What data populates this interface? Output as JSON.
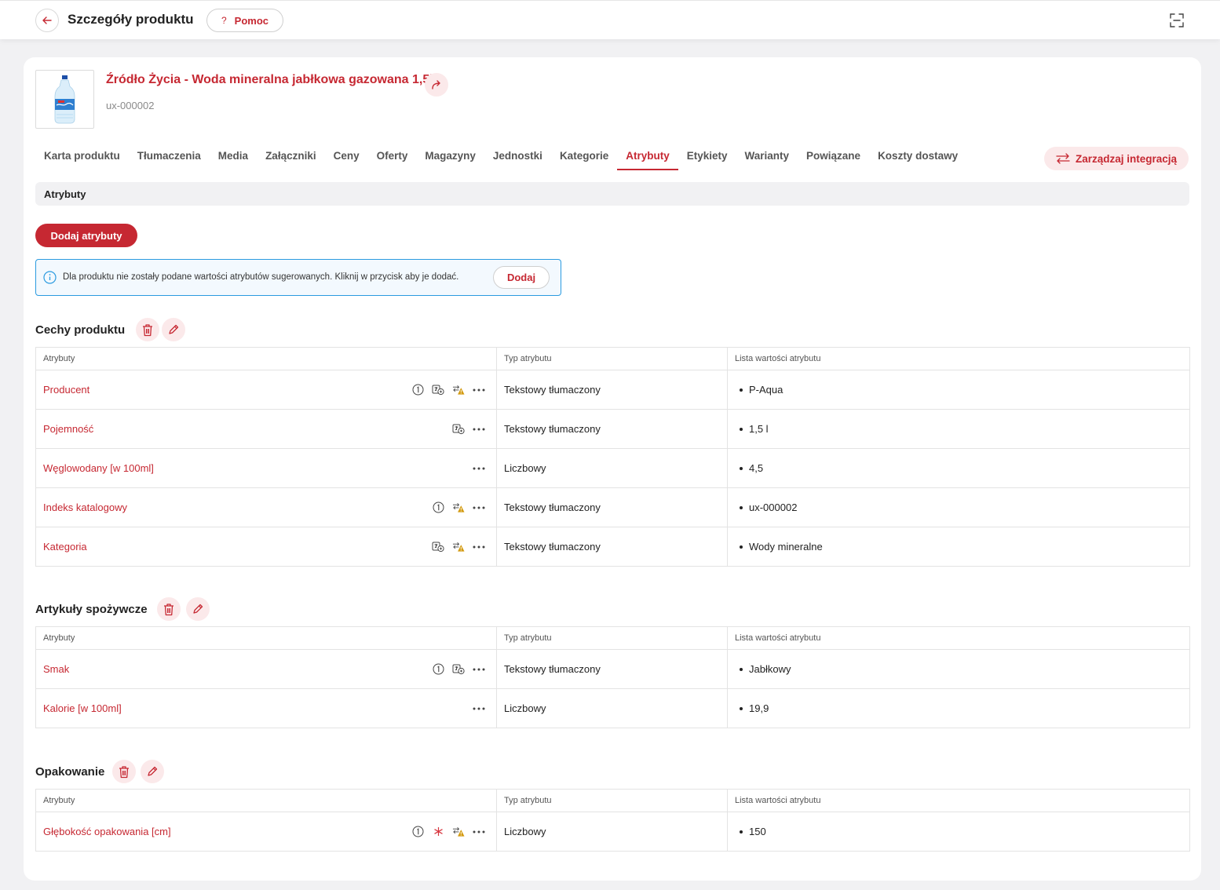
{
  "header": {
    "title": "Szczegóły produktu",
    "help_label": "Pomoc",
    "help_glyph": "?"
  },
  "product": {
    "name": "Źródło Życia - Woda mineralna jabłkowa gazowana 1,5l",
    "code": "ux-000002"
  },
  "tabs": [
    {
      "label": "Karta produktu"
    },
    {
      "label": "Tłumaczenia"
    },
    {
      "label": "Media"
    },
    {
      "label": "Załączniki"
    },
    {
      "label": "Ceny"
    },
    {
      "label": "Oferty"
    },
    {
      "label": "Magazyny"
    },
    {
      "label": "Jednostki"
    },
    {
      "label": "Kategorie"
    },
    {
      "label": "Atrybuty"
    },
    {
      "label": "Etykiety"
    },
    {
      "label": "Warianty"
    },
    {
      "label": "Powiązane"
    },
    {
      "label": "Koszty dostawy"
    }
  ],
  "active_tab": "Atrybuty",
  "integration_label": "Zarządzaj integracją",
  "section_title": "Atrybuty",
  "add_attributes_label": "Dodaj atrybuty",
  "info": {
    "text": "Dla produktu nie zostały podane wartości atrybutów sugerowanych. Kliknij w przycisk aby je dodać.",
    "button": "Dodaj"
  },
  "columns": {
    "attribute": "Atrybuty",
    "type": "Typ atrybutu",
    "values": "Lista wartości atrybutu"
  },
  "groups": [
    {
      "title": "Cechy produktu",
      "rows": [
        {
          "name": "Producent",
          "type": "Tekstowy tłumaczony",
          "value": "P-Aqua",
          "icons": [
            "number-one-icon",
            "translation-icon",
            "integration-warning-icon",
            "more-options-icon"
          ]
        },
        {
          "name": "Pojemność",
          "type": "Tekstowy tłumaczony",
          "value": "1,5 l",
          "icons": [
            "translation-icon",
            "more-options-icon"
          ]
        },
        {
          "name": "Węglowodany [w 100ml]",
          "type": "Liczbowy",
          "value": "4,5",
          "icons": [
            "more-options-icon"
          ]
        },
        {
          "name": "Indeks katalogowy",
          "type": "Tekstowy tłumaczony",
          "value": "ux-000002",
          "icons": [
            "number-one-icon",
            "integration-warning-icon",
            "more-options-icon"
          ]
        },
        {
          "name": "Kategoria",
          "type": "Tekstowy tłumaczony",
          "value": "Wody mineralne",
          "icons": [
            "translation-icon",
            "integration-warning-icon",
            "more-options-icon"
          ]
        }
      ]
    },
    {
      "title": "Artykuły spożywcze",
      "rows": [
        {
          "name": "Smak",
          "type": "Tekstowy tłumaczony",
          "value": "Jabłkowy",
          "icons": [
            "number-one-icon",
            "translation-icon",
            "more-options-icon"
          ]
        },
        {
          "name": "Kalorie [w 100ml]",
          "type": "Liczbowy",
          "value": "19,9",
          "icons": [
            "more-options-icon"
          ]
        }
      ]
    },
    {
      "title": "Opakowanie",
      "rows": [
        {
          "name": "Głębokość opakowania [cm]",
          "type": "Liczbowy",
          "value": "150",
          "icons": [
            "number-one-icon",
            "required-asterisk-icon",
            "integration-warning-icon",
            "more-options-icon"
          ]
        }
      ]
    }
  ],
  "colors": {
    "accent": "#c62832",
    "accent_soft": "#fbe9ea",
    "info_border": "#2b9be0",
    "warning": "#d39a10"
  }
}
